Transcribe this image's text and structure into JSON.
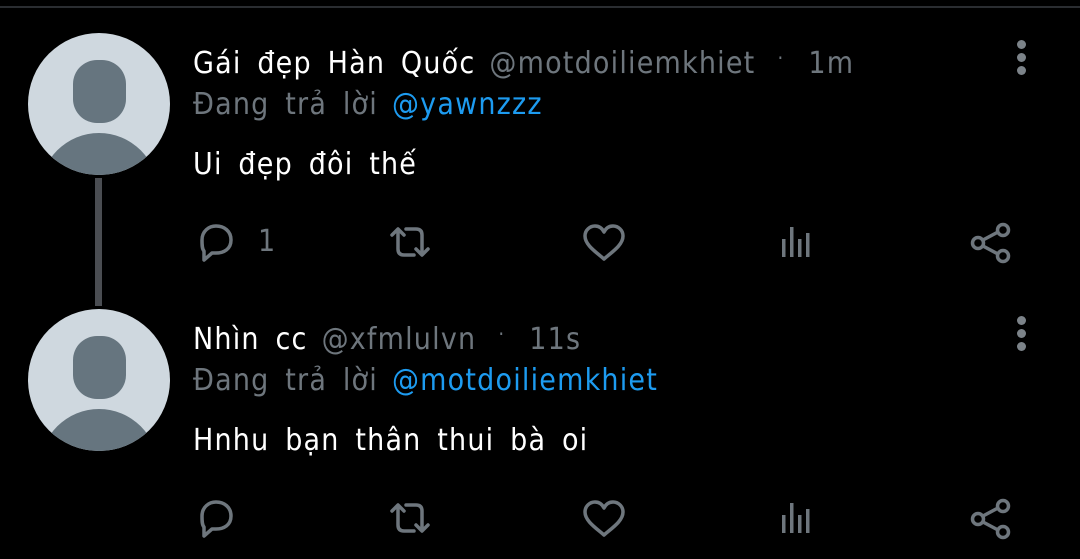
{
  "colors": {
    "background": "#000000",
    "primary_text": "#ffffff",
    "secondary_text": "#6e767d",
    "mention": "#1d9bf0",
    "avatar_bg": "#cfd8df",
    "avatar_fg": "#66757f"
  },
  "tweets": [
    {
      "display_name": "Gái đẹp Hàn Quốc",
      "handle": "@motdoiliemkhiet",
      "separator": "·",
      "time": "1m",
      "reply_prefix": "Đang trả lời",
      "reply_to": "@yawnzzz",
      "text": "Ui đẹp đôi thế",
      "reply_count": "1",
      "icons": [
        "reply-icon",
        "retweet-icon",
        "like-icon",
        "analytics-icon",
        "share-icon"
      ]
    },
    {
      "display_name": "Nhìn cc",
      "handle": "@xfmlulvn",
      "separator": "·",
      "time": "11s",
      "reply_prefix": "Đang trả lời",
      "reply_to": "@motdoiliemkhiet",
      "text": "Hnhu bạn thân thui bà oi",
      "reply_count": "",
      "icons": [
        "reply-icon",
        "retweet-icon",
        "like-icon",
        "analytics-icon",
        "share-icon"
      ]
    }
  ]
}
